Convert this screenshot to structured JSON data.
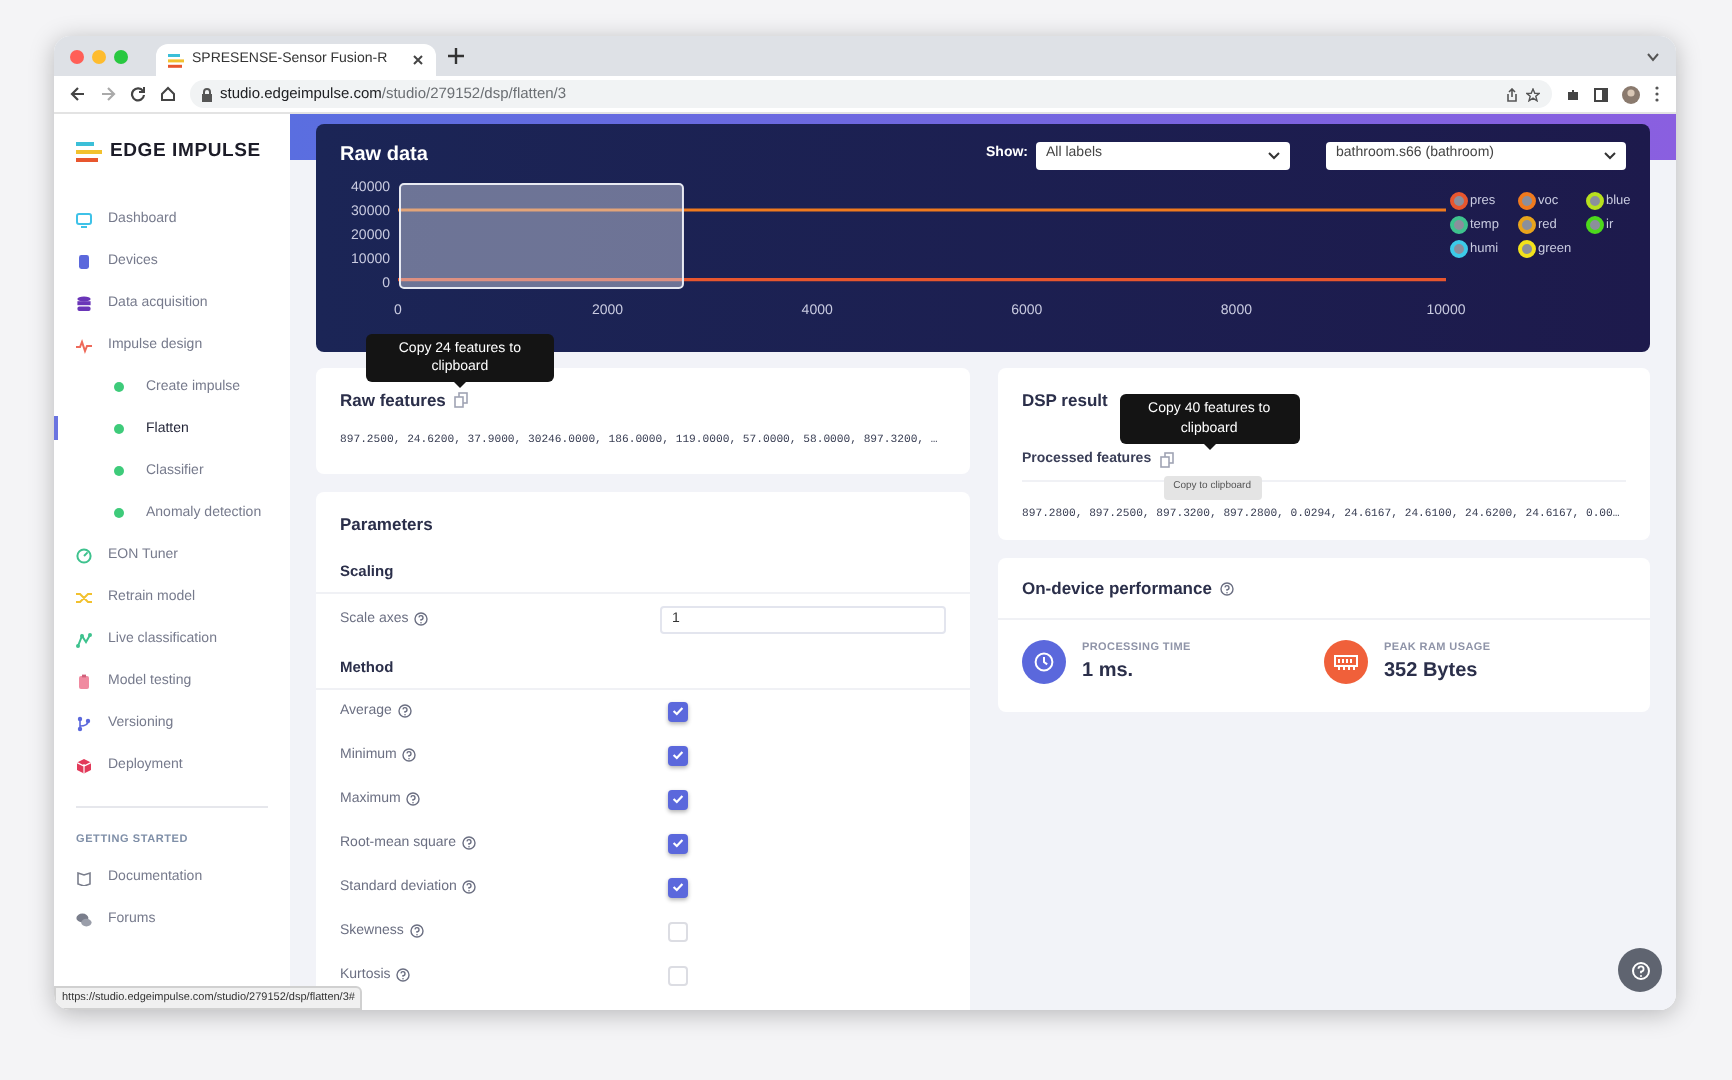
{
  "browser": {
    "tab_title": "SPRESENSE-Sensor Fusion-R",
    "url_host": "studio.edgeimpulse.com",
    "url_path": "/studio/279152/dsp/flatten/3",
    "status_url": "https://studio.edgeimpulse.com/studio/279152/dsp/flatten/3#"
  },
  "sidebar": {
    "logo_text": "EDGE IMPULSE",
    "items": [
      {
        "label": "Dashboard",
        "selected": false
      },
      {
        "label": "Devices",
        "selected": false
      },
      {
        "label": "Data acquisition",
        "selected": false
      },
      {
        "label": "Impulse design",
        "selected": false,
        "children": [
          {
            "label": "Create impulse",
            "selected": false
          },
          {
            "label": "Flatten",
            "selected": true
          },
          {
            "label": "Classifier",
            "selected": false
          },
          {
            "label": "Anomaly detection",
            "selected": false
          }
        ]
      },
      {
        "label": "EON Tuner",
        "selected": false
      },
      {
        "label": "Retrain model",
        "selected": false
      },
      {
        "label": "Live classification",
        "selected": false
      },
      {
        "label": "Model testing",
        "selected": false
      },
      {
        "label": "Versioning",
        "selected": false
      },
      {
        "label": "Deployment",
        "selected": false
      }
    ],
    "section_heading": "GETTING STARTED",
    "help_items": [
      {
        "label": "Documentation"
      },
      {
        "label": "Forums"
      }
    ]
  },
  "raw_data": {
    "title": "Raw data",
    "show_label": "Show:",
    "label_select": "All labels",
    "sample_select": "bathroom.s66 (bathroom)",
    "chart_data": {
      "type": "line",
      "x": [
        0,
        10000
      ],
      "xlim": [
        0,
        10000
      ],
      "ylim": [
        0,
        40000
      ],
      "xticks": [
        0,
        2000,
        4000,
        6000,
        8000,
        10000
      ],
      "yticks": [
        0,
        10000,
        20000,
        30000,
        40000
      ],
      "series": [
        {
          "name": "pres",
          "color": "#e8562e",
          "values": [
            1000,
            1000
          ]
        },
        {
          "name": "voc",
          "color": "#f07a1e",
          "values": [
            30000,
            30000
          ]
        },
        {
          "name": "blue",
          "color": "#b8e01e",
          "values": [
            null,
            null
          ]
        },
        {
          "name": "temp",
          "color": "#3ec28e",
          "values": [
            null,
            null
          ]
        },
        {
          "name": "red",
          "color": "#e8a41c",
          "values": [
            null,
            null
          ]
        },
        {
          "name": "ir",
          "color": "#4cd81c",
          "values": [
            null,
            null
          ]
        },
        {
          "name": "humi",
          "color": "#3ccbe8",
          "values": [
            null,
            null
          ]
        },
        {
          "name": "green",
          "color": "#f2e21c",
          "values": [
            null,
            null
          ]
        }
      ]
    }
  },
  "raw_features": {
    "title": "Raw features",
    "tooltip": "Copy 24 features to clipboard",
    "values": "897.2500, 24.6200, 37.9000, 30246.0000, 186.0000, 119.0000, 57.0000, 58.0000, 897.3200, …"
  },
  "parameters": {
    "title": "Parameters",
    "sections": [
      {
        "heading": "Scaling",
        "rows": [
          {
            "kind": "number",
            "label": "Scale axes",
            "value": "1"
          }
        ]
      },
      {
        "heading": "Method",
        "rows": [
          {
            "kind": "checkbox",
            "label": "Average",
            "checked": true
          },
          {
            "kind": "checkbox",
            "label": "Minimum",
            "checked": true
          },
          {
            "kind": "checkbox",
            "label": "Maximum",
            "checked": true
          },
          {
            "kind": "checkbox",
            "label": "Root-mean square",
            "checked": true
          },
          {
            "kind": "checkbox",
            "label": "Standard deviation",
            "checked": true
          },
          {
            "kind": "checkbox",
            "label": "Skewness",
            "checked": false
          },
          {
            "kind": "checkbox",
            "label": "Kurtosis",
            "checked": false
          }
        ]
      }
    ]
  },
  "dsp_result": {
    "title": "DSP result",
    "subtitle": "Processed features",
    "tooltip": "Copy 40 features to clipboard",
    "hint": "Copy to clipboard",
    "values": "897.2800, 897.2500, 897.3200, 897.2800, 0.0294, 24.6167, 24.6100, 24.6200, 24.6167, 0.00…"
  },
  "performance": {
    "title": "On-device performance",
    "metrics": [
      {
        "kind": "time",
        "label": "PROCESSING TIME",
        "value": "1 ms."
      },
      {
        "kind": "ram",
        "label": "PEAK RAM USAGE",
        "value": "352 Bytes"
      }
    ]
  }
}
